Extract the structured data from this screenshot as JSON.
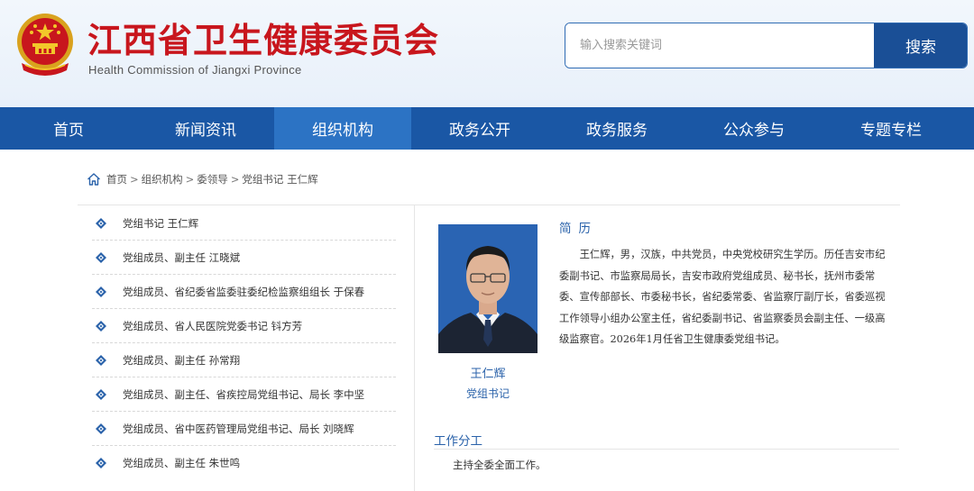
{
  "header": {
    "title": "江西省卫生健康委员会",
    "subtitle": "Health Commission of Jiangxi Province",
    "search": {
      "placeholder": "输入搜索关键词",
      "button_label": "搜索"
    }
  },
  "nav": {
    "items": [
      {
        "label": "首页"
      },
      {
        "label": "新闻资讯"
      },
      {
        "label": "组织机构"
      },
      {
        "label": "政务公开"
      },
      {
        "label": "政务服务"
      },
      {
        "label": "公众参与"
      },
      {
        "label": "专题专栏"
      }
    ],
    "active_index": 2
  },
  "breadcrumb": {
    "items": [
      "首页",
      "组织机构",
      "委领导"
    ],
    "separator": ">",
    "current": "党组书记 王仁辉"
  },
  "leaders": [
    "党组书记 王仁辉",
    "党组成员、副主任 江晓斌",
    "党组成员、省纪委省监委驻委纪检监察组组长 于保春",
    "党组成员、省人民医院党委书记 钭方芳",
    "党组成员、副主任 孙常翔",
    "党组成员、副主任、省疾控局党组书记、局长 李中坚",
    "党组成员、省中医药管理局党组书记、局长 刘晓辉",
    "党组成员、副主任 朱世鸣"
  ],
  "profile": {
    "name": "王仁辉",
    "title": "党组书记",
    "bio_heading": "简历",
    "bio": "王仁辉，男，汉族，中共党员，中央党校研究生学历。历任吉安市纪委副书记、市监察局局长，吉安市政府党组成员、秘书长，抚州市委常委、宣传部部长、市委秘书长，省纪委常委、省监察厅副厅长，省委巡视工作领导小组办公室主任，省纪委副书记、省监察委员会副主任、一级高级监察官。2026年1月任省卫生健康委党组书记。",
    "duty_heading": "工作分工",
    "duty": "主持全委全面工作。"
  },
  "colors": {
    "title_red": "#c8161d",
    "nav_blue": "#1a57a5",
    "nav_active": "#2c73c4",
    "accent_blue": "#2a62aa",
    "search_button": "#1a4f96"
  }
}
